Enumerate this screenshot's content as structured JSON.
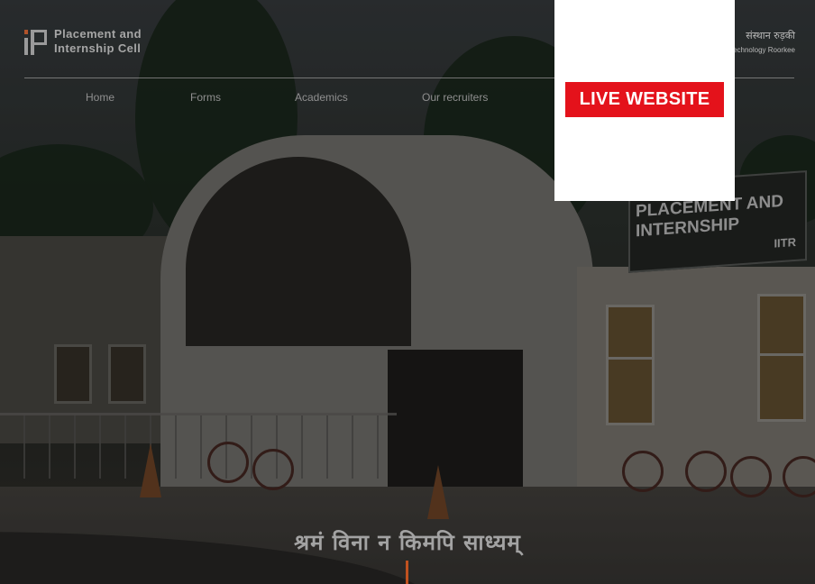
{
  "header": {
    "brand_line1": "Placement and",
    "brand_line2": "Internship Cell",
    "institute_hindi": "संस्थान रुड़की",
    "institute_english": "Technology Roorkee"
  },
  "nav": {
    "items": [
      {
        "label": "Home"
      },
      {
        "label": "Forms"
      },
      {
        "label": "Academics"
      },
      {
        "label": "Our recruiters"
      }
    ]
  },
  "overlay": {
    "live_button_label": "LIVE WEBSITE"
  },
  "background_sign": {
    "line1": "PLACEMENT AND",
    "line2": "INTERNSHIP",
    "line3": "IITR"
  },
  "motto": "श्रमं विना न किमपि साध्यम्",
  "colors": {
    "accent_orange": "#c0511f",
    "live_red": "#e4121b"
  }
}
